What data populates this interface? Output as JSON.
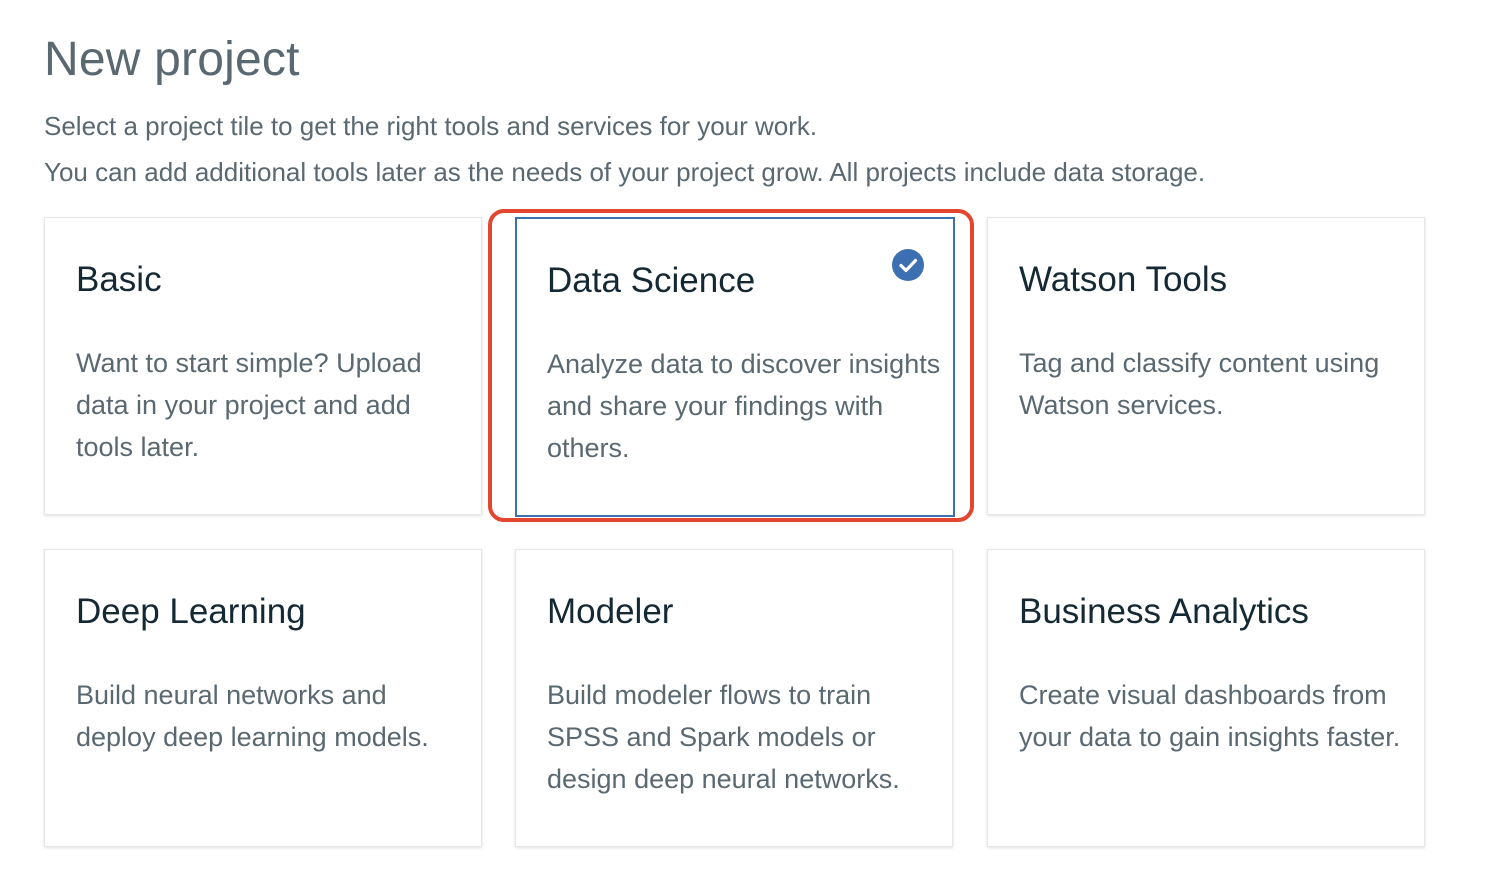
{
  "header": {
    "title": "New project",
    "description_line1": "Select a project tile to get the right tools and services for your work.",
    "description_line2": "You can add additional tools later as the needs of your project grow. All projects include data storage."
  },
  "tiles": [
    {
      "name": "Basic",
      "description": "Want to start simple? Upload data in your project and add tools later.",
      "selected": false
    },
    {
      "name": "Data Science",
      "description": "Analyze data to discover insights and share your findings with others.",
      "selected": true
    },
    {
      "name": "Watson Tools",
      "description": "Tag and classify content using Watson services.",
      "selected": false
    },
    {
      "name": "Deep Learning",
      "description": "Build neural networks and deploy deep learning models.",
      "selected": false
    },
    {
      "name": "Modeler",
      "description": "Build modeler flows to train SPSS and Spark models or design deep neural networks.",
      "selected": false
    },
    {
      "name": "Business Analytics",
      "description": "Create visual dashboards from your data to gain insights faster.",
      "selected": false
    }
  ],
  "icons": {
    "selected_indicator": "checkmark-circle-icon"
  },
  "colors": {
    "accent": "#3d70b2",
    "highlight_ring": "#e2462f",
    "title_text": "#152935",
    "body_text": "#5a6872",
    "tile_border": "#e6e6e6",
    "background": "#ffffff"
  }
}
